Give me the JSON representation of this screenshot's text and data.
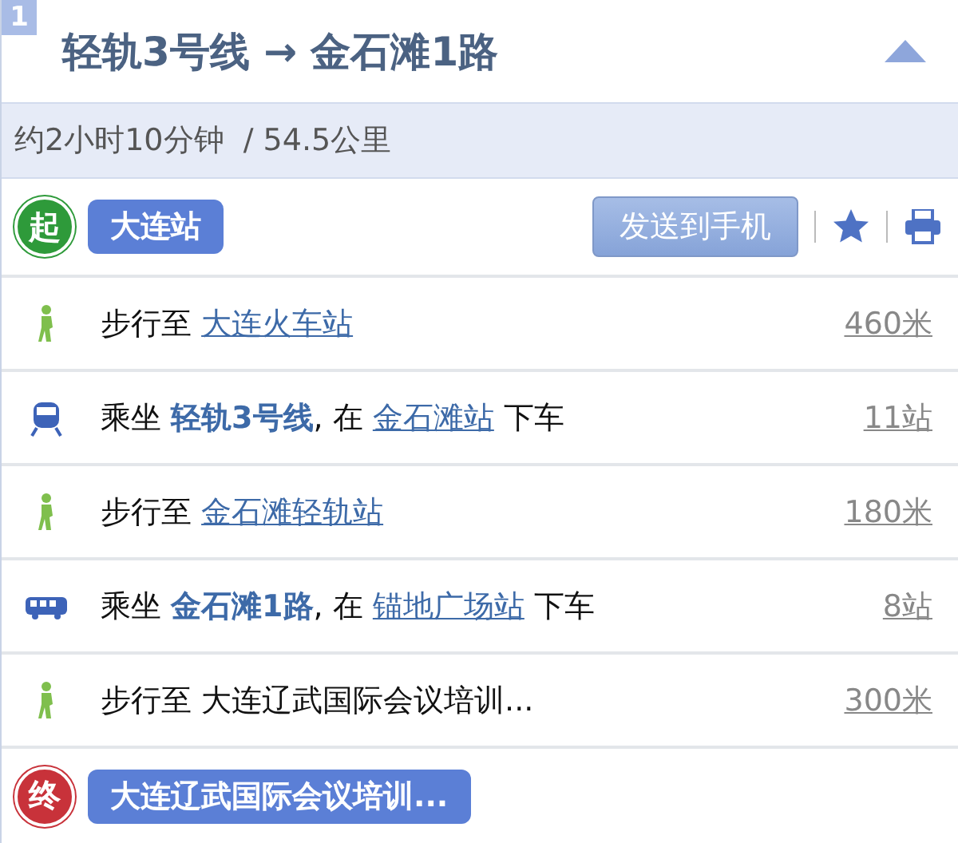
{
  "route": {
    "index": "1",
    "title": "轻轨3号线 → 金石滩1路",
    "expanded": true
  },
  "summary": "约2小时10分钟  / 54.5公里",
  "start": {
    "marker": "起",
    "name": "大连站"
  },
  "send_button": "发送到手机",
  "steps": [
    {
      "kind": "walk",
      "before": "步行至",
      "link": "大连火车站",
      "distance": "460米"
    },
    {
      "kind": "rail",
      "before": "乘坐 **轻轨3号线**, 在",
      "link": "金石滩站",
      "after": "下车",
      "distance": "11站"
    },
    {
      "kind": "walk",
      "before": "步行至",
      "link": "金石滩轻轨站",
      "distance": "180米"
    },
    {
      "kind": "bus",
      "before": "乘坐 **金石滩1路**, 在",
      "link": "锚地广场站",
      "after": "下车",
      "distance": "8站"
    },
    {
      "kind": "walk",
      "before": "步行至 大连辽武国际会议培训...",
      "distance": "300米"
    }
  ],
  "end": {
    "marker": "终",
    "name": "大连辽武国际会议培训..."
  }
}
